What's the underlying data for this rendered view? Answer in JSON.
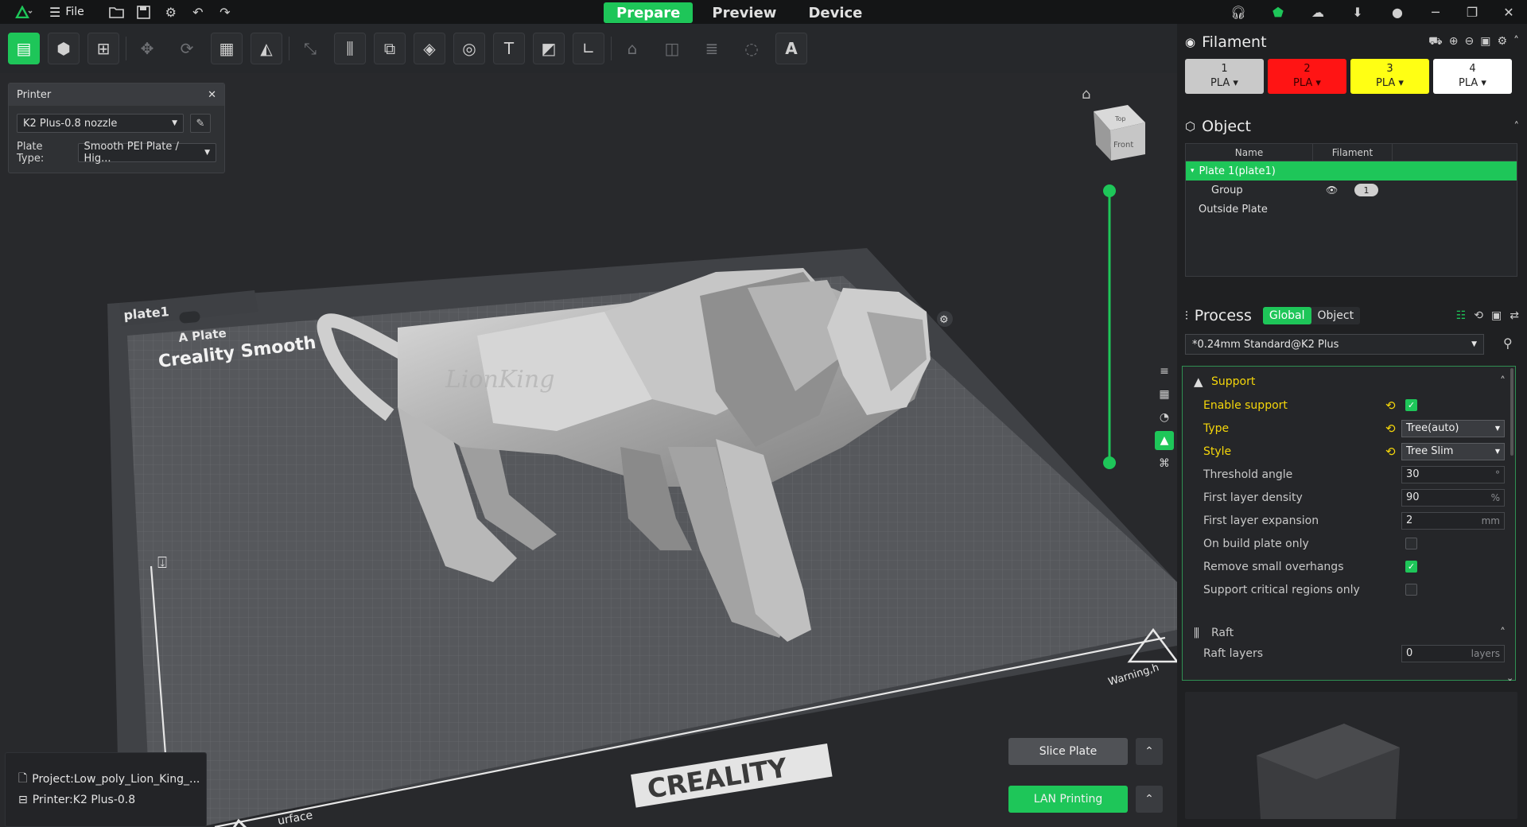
{
  "topbar": {
    "file_label": "File",
    "tabs": [
      {
        "label": "Prepare",
        "active": true
      },
      {
        "label": "Preview",
        "active": false
      },
      {
        "label": "Device",
        "active": false
      }
    ]
  },
  "printer_panel": {
    "title": "Printer",
    "printer_value": "K2 Plus-0.8 nozzle",
    "plate_type_label": "Plate Type:",
    "plate_type_value": "Smooth PEI Plate / Hig..."
  },
  "scene": {
    "plate_label": "plate1",
    "bed_text_1": "A Plate",
    "bed_text_2": "Creality Smooth",
    "bed_brand": "CREALITY",
    "bed_warning": "Warning,h",
    "bed_surface": "urface",
    "view_cube_top": "Top",
    "view_cube_front": "Front",
    "model_watermark": "LionKing",
    "model_name": "Low-poly lion"
  },
  "project_info": {
    "project": "Project:Low_poly_Lion_King_...",
    "printer": "Printer:K2 Plus-0.8"
  },
  "actions": {
    "slice": "Slice Plate",
    "lan": "LAN Printing"
  },
  "filament": {
    "title": "Filament",
    "slots": [
      {
        "num": "1",
        "type": "PLA",
        "color": "#c9c9c9",
        "text": "#222222"
      },
      {
        "num": "2",
        "type": "PLA",
        "color": "#ff1414",
        "text": "#3a0000"
      },
      {
        "num": "3",
        "type": "PLA",
        "color": "#ffff14",
        "text": "#222222"
      },
      {
        "num": "4",
        "type": "PLA",
        "color": "#ffffff",
        "text": "#222222"
      }
    ]
  },
  "object": {
    "title": "Object",
    "col_name": "Name",
    "col_filament": "Filament",
    "rows": [
      {
        "name": "Plate 1(plate1)"
      },
      {
        "name": "Group",
        "filament": "1"
      },
      {
        "name": "Outside Plate"
      }
    ]
  },
  "process": {
    "title": "Process",
    "tab_global": "Global",
    "tab_object": "Object",
    "preset": "*0.24mm Standard@K2 Plus",
    "support_group": "Support",
    "raft_group": "Raft",
    "settings": [
      {
        "label": "Enable support",
        "modified": true,
        "kind": "check",
        "checked": true
      },
      {
        "label": "Type",
        "modified": true,
        "kind": "select",
        "value": "Tree(auto)"
      },
      {
        "label": "Style",
        "modified": true,
        "kind": "select",
        "value": "Tree Slim"
      },
      {
        "label": "Threshold angle",
        "kind": "input",
        "value": "30",
        "unit": "°"
      },
      {
        "label": "First layer density",
        "kind": "input",
        "value": "90",
        "unit": "%"
      },
      {
        "label": "First layer expansion",
        "kind": "input",
        "value": "2",
        "unit": "mm"
      },
      {
        "label": "On build plate only",
        "kind": "check",
        "checked": false
      },
      {
        "label": "Remove small overhangs",
        "kind": "check",
        "checked": true
      },
      {
        "label": "Support critical regions only",
        "kind": "check",
        "checked": false
      }
    ],
    "raft_layers_label": "Raft layers",
    "raft_layers_value": "0",
    "raft_layers_unit": "layers"
  },
  "colors": {
    "accent": "#1ec659",
    "modified": "#f5d60a"
  }
}
